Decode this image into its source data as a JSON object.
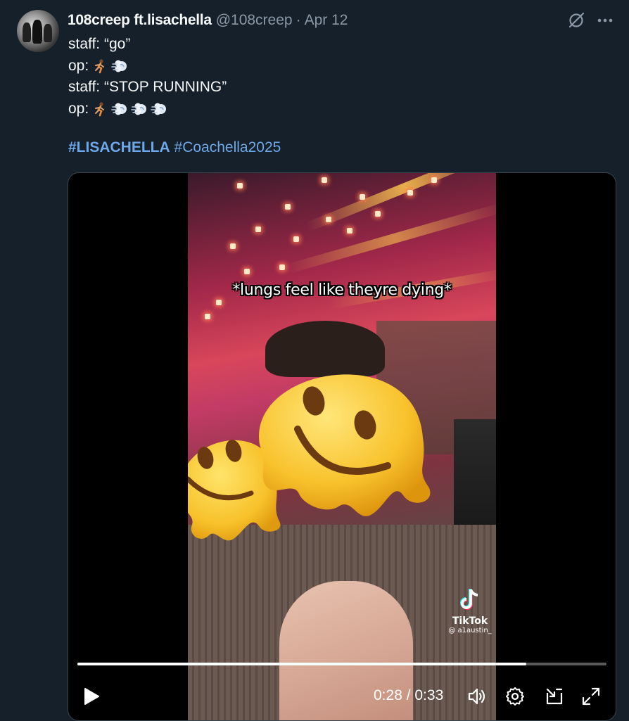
{
  "tweet": {
    "display_name": "108creep ft.lisachella",
    "handle": "@108creep",
    "separator": "·",
    "date": "Apr 12",
    "lines": [
      {
        "text": "staff: “go”",
        "emojis": []
      },
      {
        "text": "op:",
        "emojis": [
          "runner",
          "dash"
        ]
      },
      {
        "text": "staff: “STOP RUNNING”",
        "emojis": []
      },
      {
        "text": "op:",
        "emojis": [
          "runner",
          "dash",
          "dash",
          "dash"
        ]
      }
    ],
    "hashtags": [
      {
        "text": "#LISACHELLA",
        "bold": true
      },
      {
        "text": "#Coachella2025",
        "bold": false
      }
    ]
  },
  "top_icons": [
    "grok-icon",
    "more-icon"
  ],
  "video": {
    "caption": "*lungs feel like theyre dying*",
    "watermark_name": "TikTok",
    "watermark_user": "@ a1austin_",
    "elapsed": "0:28",
    "duration": "0:33",
    "time_display": "0:28 / 0:33",
    "progress_fraction": 0.8485
  },
  "colors": {
    "background": "#15202b",
    "text": "#f7f9f9",
    "muted": "#8b98a5",
    "link": "#6fa8e8",
    "media_border": "#38444d"
  }
}
